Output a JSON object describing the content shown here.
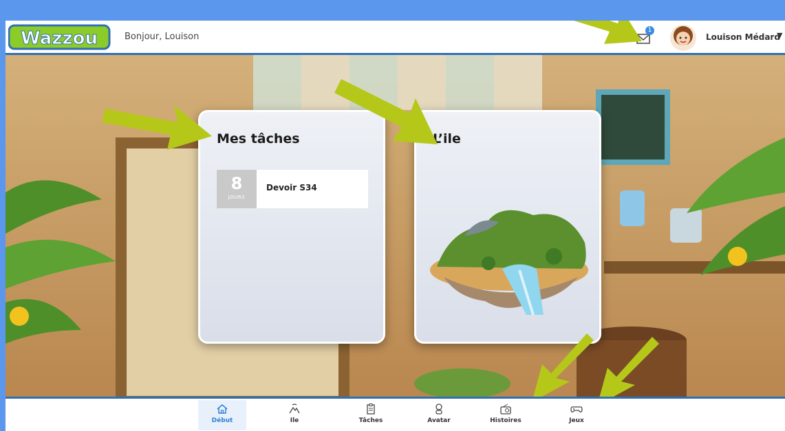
{
  "header": {
    "logo_text": "Wazzou",
    "greeting": "Bonjour, Louison",
    "mail_badge": "1",
    "user_name": "Louison Médard",
    "chevron": "▼"
  },
  "cards": {
    "tasks": {
      "title": "Mes tâches",
      "item": {
        "days": "8",
        "days_unit": "JOURS",
        "name": "Devoir S34"
      }
    },
    "island": {
      "title": "L’ile"
    }
  },
  "nav": {
    "items": [
      {
        "label": "Début",
        "icon": "home-icon",
        "active": true
      },
      {
        "label": "Ile",
        "icon": "island-icon"
      },
      {
        "label": "Tâches",
        "icon": "clipboard-icon"
      },
      {
        "label": "Avatar",
        "icon": "avatar-icon"
      },
      {
        "label": "Histoires",
        "icon": "radio-icon"
      },
      {
        "label": "Jeux",
        "icon": "gamepad-icon"
      }
    ]
  },
  "colors": {
    "outer_background": "#5b97ec",
    "accent_blue": "#2f6fb5",
    "active_nav": "#2f80d4",
    "arrow_green": "#b5c81a"
  }
}
